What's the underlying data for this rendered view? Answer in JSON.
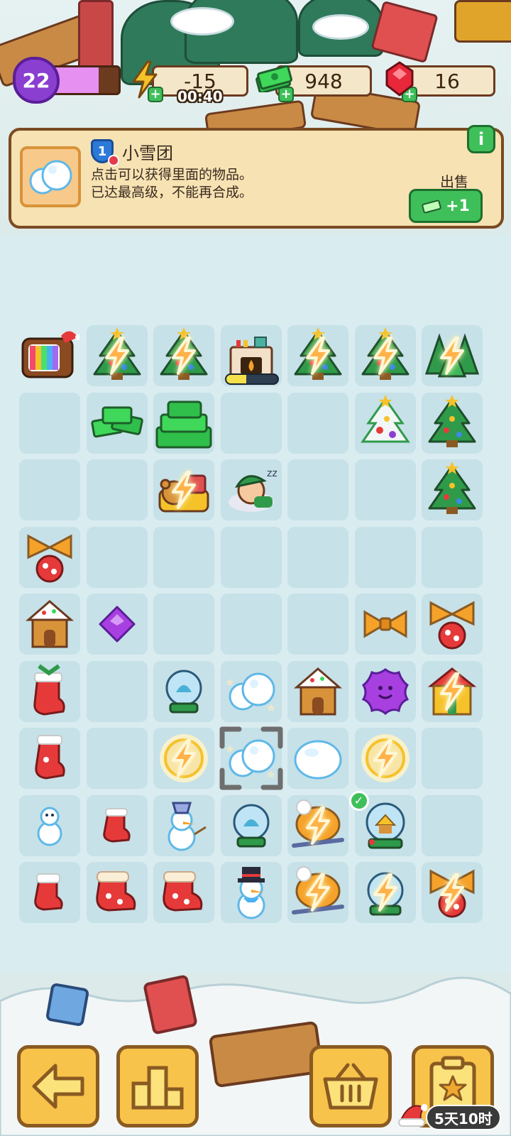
{
  "hud": {
    "level": "22",
    "xp_fraction": 0.7,
    "energy": "-15",
    "energy_timer": "00:40",
    "cash": "948",
    "gems": "16"
  },
  "info": {
    "item_level": "1",
    "item_name": "小雪团",
    "description": "点击可以获得里面的物品。\n已达最高级，不能再合成。",
    "sell_label": "出售",
    "sell_reward": "+1",
    "info_button": "i"
  },
  "board": {
    "fireplace_progress": 0.4
  },
  "footer": {
    "event_timer": "5天10时"
  },
  "colors": {
    "accent_green": "#3fbf5a",
    "panel": "#f6e2b2",
    "wood": "#7a4a22",
    "button_yellow": "#f7c34a"
  }
}
